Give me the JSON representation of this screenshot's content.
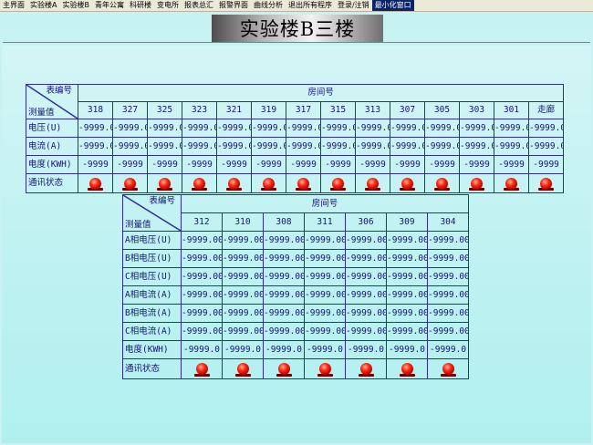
{
  "menu": {
    "items": [
      "主界面",
      "实验楼A",
      "实验楼B",
      "青年公寓",
      "科研楼",
      "变电所",
      "报表总汇",
      "报警界面",
      "曲线分析",
      "退出所有程序",
      "登录/注销",
      "最小化窗口"
    ],
    "active_index": 11
  },
  "title": "实验楼B三楼",
  "table1": {
    "corner_top": "表编号",
    "corner_bottom": "测量值",
    "room_header": "房间号",
    "rooms": [
      "318",
      "327",
      "325",
      "323",
      "321",
      "319",
      "317",
      "315",
      "313",
      "307",
      "305",
      "303",
      "301",
      "走廊"
    ],
    "rows": [
      {
        "label": "电压(U)",
        "values": [
          "-9999.00",
          "-9999.00",
          "-9999.00",
          "-9999.00",
          "-9999.00",
          "-9999.00",
          "-9999.00",
          "-9999.00",
          "-9999.00",
          "-9999.00",
          "-9999.00",
          "-9999.00",
          "-9999.00",
          "-9999.00"
        ]
      },
      {
        "label": "电流(A)",
        "values": [
          "-9999.00",
          "-9999.00",
          "-9999.00",
          "-9999.00",
          "-9999.00",
          "-9999.00",
          "-9999.00",
          "-9999.00",
          "-9999.00",
          "-9999.00",
          "-9999.00",
          "-9999.00",
          "-9999.00",
          "-9999.00"
        ]
      },
      {
        "label": "电度(KWH)",
        "values": [
          "-9999",
          "-9999",
          "-9999",
          "-9999",
          "-9999",
          "-9999",
          "-9999",
          "-9999",
          "-9999",
          "-9999",
          "-9999",
          "-9999",
          "-9999",
          "-9999"
        ]
      }
    ],
    "status_label": "通讯状态",
    "status_color": "#ff2a10"
  },
  "table2": {
    "corner_top": "表编号",
    "corner_bottom": "测量值",
    "room_header": "房间号",
    "rooms": [
      "312",
      "310",
      "308",
      "311",
      "306",
      "309",
      "304"
    ],
    "rows": [
      {
        "label": "A相电压(U)",
        "values": [
          "-9999.00",
          "-9999.00",
          "-9999.00",
          "-9999.00",
          "-9999.00",
          "-9999.00",
          "-9999.00"
        ]
      },
      {
        "label": "B相电压(U)",
        "values": [
          "-9999.00",
          "-9999.00",
          "-9999.00",
          "-9999.00",
          "-9999.00",
          "-9999.00",
          "-9999.00"
        ]
      },
      {
        "label": "C相电压(U)",
        "values": [
          "-9999.00",
          "-9999.00",
          "-9999.00",
          "-9999.00",
          "-9999.00",
          "-9999.00",
          "-9999.00"
        ]
      },
      {
        "label": "A相电流(A)",
        "values": [
          "-9999.00",
          "-9999.00",
          "-9999.00",
          "-9999.00",
          "-9999.00",
          "-9999.00",
          "-9999.00"
        ]
      },
      {
        "label": "B相电流(A)",
        "values": [
          "-9999.00",
          "-9999.00",
          "-9999.00",
          "-9999.00",
          "-9999.00",
          "-9999.00",
          "-9999.00"
        ]
      },
      {
        "label": "C相电流(A)",
        "values": [
          "-9999.00",
          "-9999.00",
          "-9999.00",
          "-9999.00",
          "-9999.00",
          "-9999.00",
          "-9999.00"
        ]
      },
      {
        "label": "电度(KWH)",
        "values": [
          "-9999.0",
          "-9999.0",
          "-9999.0",
          "-9999.0",
          "-9999.0",
          "-9999.0",
          "-9999.0"
        ]
      }
    ],
    "status_label": "通讯状态",
    "status_color": "#ff2a10"
  }
}
